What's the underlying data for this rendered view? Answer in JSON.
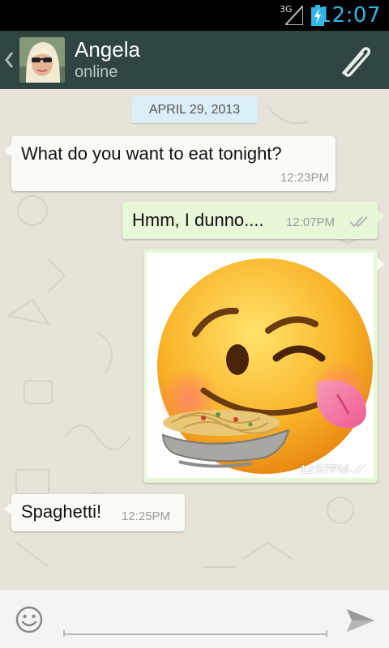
{
  "status_bar": {
    "network": "3G",
    "time": "12:07"
  },
  "header": {
    "contact_name": "Angela",
    "contact_status": "online",
    "back_icon": "chevron-left-icon",
    "avatar_icon": "avatar-photo",
    "attach_icon": "paperclip-icon"
  },
  "chat": {
    "date_label": "APRIL 29, 2013",
    "messages": [
      {
        "direction": "incoming",
        "text": "What do you want to eat tonight?",
        "time": "12:23PM"
      },
      {
        "direction": "outgoing",
        "text": "Hmm, I dunno....",
        "time": "12:07PM",
        "status": "read-ticks"
      },
      {
        "direction": "outgoing",
        "type": "image",
        "image": "winking-emoji-with-noodles",
        "time": "12:07PM",
        "status": "read-ticks"
      },
      {
        "direction": "incoming",
        "text": "Spaghetti!",
        "time": "12:25PM"
      }
    ]
  },
  "input_bar": {
    "emoji_icon": "smiley-icon",
    "placeholder": "",
    "value": "",
    "send_icon": "send-icon"
  },
  "colors": {
    "header_bg": "#2e4542",
    "clock": "#33b5e5",
    "incoming_bubble": "#fbfbf6",
    "outgoing_bubble": "#e9f7d9",
    "date_chip": "#d9eef5"
  }
}
